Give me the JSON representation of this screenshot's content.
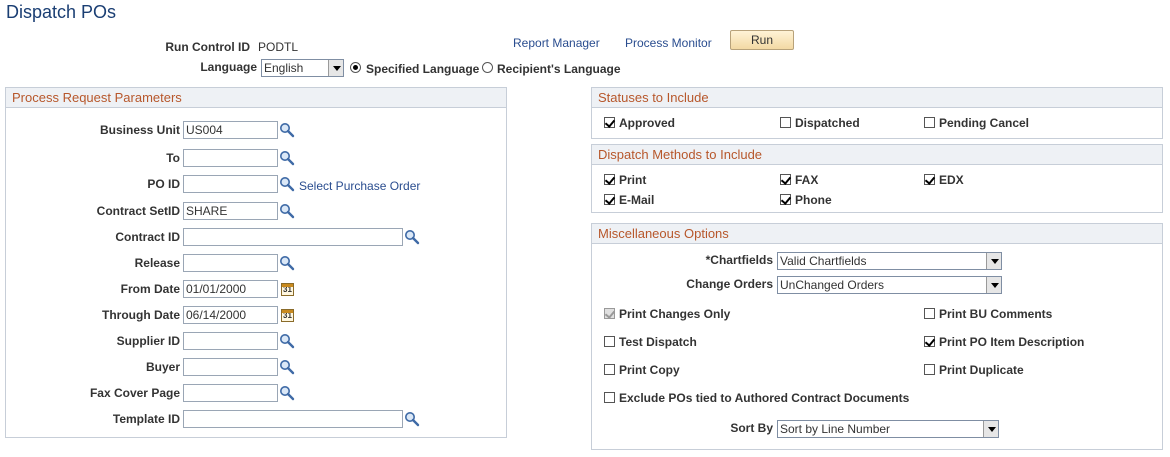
{
  "page": {
    "title": "Dispatch POs"
  },
  "header": {
    "run_control_label": "Run Control ID",
    "run_control_value": "PODTL",
    "report_manager_link": "Report Manager",
    "process_monitor_link": "Process Monitor",
    "run_button": "Run",
    "language_label": "Language",
    "language_value": "English",
    "specified_language_label": "Specified Language",
    "recipient_language_label": "Recipient's Language",
    "language_mode": "specified"
  },
  "process_request": {
    "title": "Process Request Parameters",
    "select_po_link": "Select Purchase Order",
    "fields": [
      {
        "label": "Business Unit",
        "value": "US004"
      },
      {
        "label": "To",
        "value": ""
      },
      {
        "label": "PO ID",
        "value": ""
      },
      {
        "label": "Contract SetID",
        "value": "SHARE"
      },
      {
        "label": "Contract ID",
        "value": ""
      },
      {
        "label": "Release",
        "value": ""
      },
      {
        "label": "From Date",
        "value": "01/01/2000"
      },
      {
        "label": "Through Date",
        "value": "06/14/2000"
      },
      {
        "label": "Supplier ID",
        "value": ""
      },
      {
        "label": "Buyer",
        "value": ""
      },
      {
        "label": "Fax Cover Page",
        "value": ""
      },
      {
        "label": "Template ID",
        "value": ""
      }
    ]
  },
  "statuses": {
    "title": "Statuses to Include",
    "items": [
      {
        "label": "Approved",
        "checked": true
      },
      {
        "label": "Dispatched",
        "checked": false
      },
      {
        "label": "Pending Cancel",
        "checked": false
      }
    ]
  },
  "dispatch_methods": {
    "title": "Dispatch Methods to Include",
    "items": [
      {
        "label": "Print",
        "checked": true
      },
      {
        "label": "FAX",
        "checked": true
      },
      {
        "label": "EDX",
        "checked": true
      },
      {
        "label": "E-Mail",
        "checked": true
      },
      {
        "label": "Phone",
        "checked": true
      }
    ]
  },
  "misc": {
    "title": "Miscellaneous Options",
    "chartfields_label": "*Chartfields",
    "chartfields_value": "Valid Chartfields",
    "change_orders_label": "Change Orders",
    "change_orders_value": "UnChanged Orders",
    "sort_by_label": "Sort By",
    "sort_by_value": "Sort by Line Number",
    "options": [
      {
        "label": "Print Changes Only",
        "checked": true,
        "disabled": true
      },
      {
        "label": "Print BU Comments",
        "checked": false
      },
      {
        "label": "Test Dispatch",
        "checked": false
      },
      {
        "label": "Print PO Item Description",
        "checked": true
      },
      {
        "label": "Print Copy",
        "checked": false
      },
      {
        "label": "Print Duplicate",
        "checked": false
      },
      {
        "label": "Exclude POs tied to Authored Contract Documents",
        "checked": false
      }
    ]
  },
  "icons": {
    "lookup": "magnifier-icon",
    "calendar": "calendar-icon",
    "calendar_glyph": "31"
  }
}
